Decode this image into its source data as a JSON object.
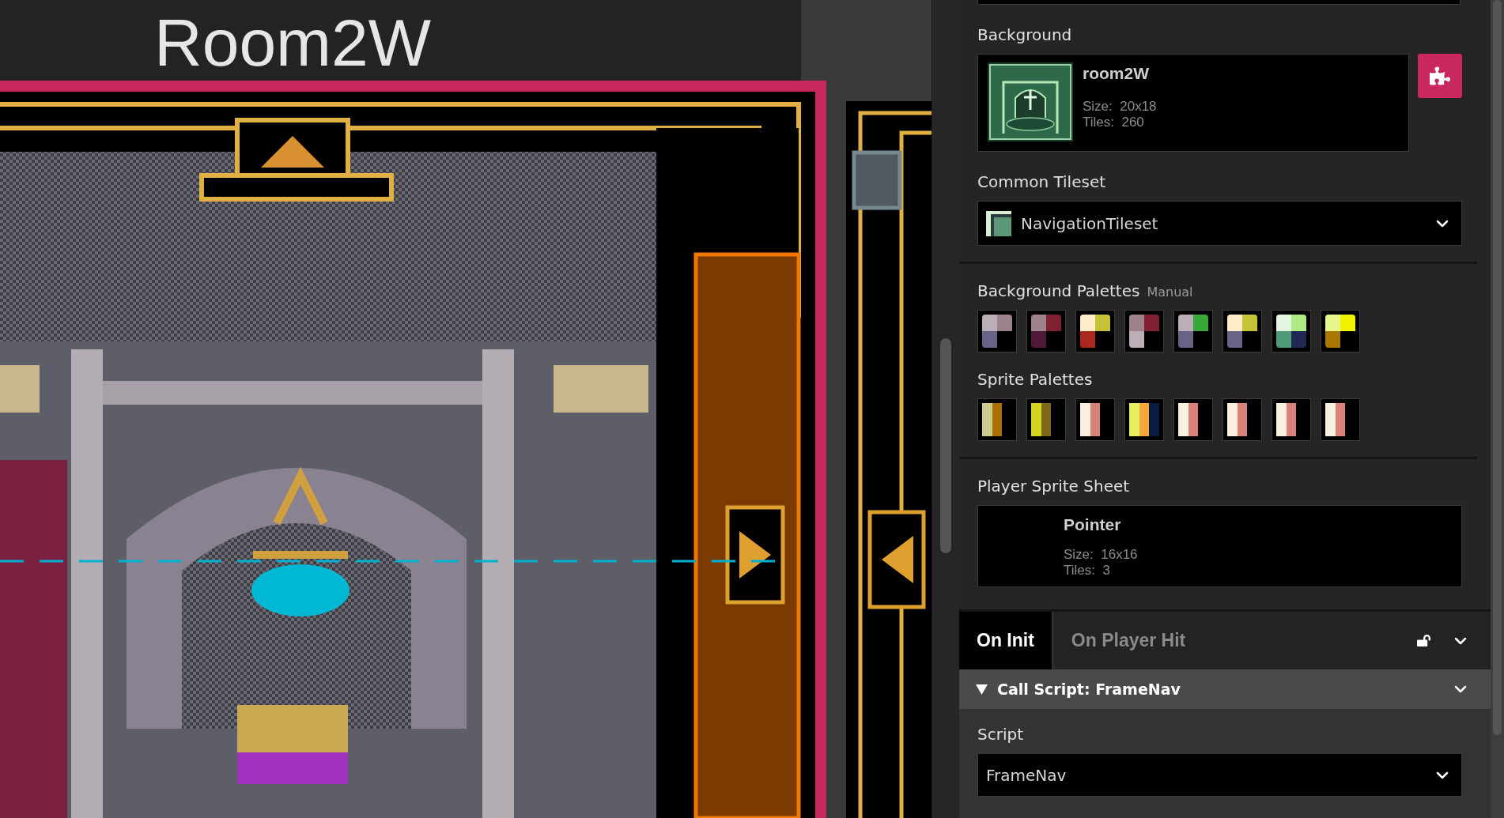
{
  "scene": {
    "title": "Room2W"
  },
  "sidebar": {
    "background": {
      "label": "Background",
      "name": "room2W",
      "size_label": "Size:",
      "size": "20x18",
      "tiles_label": "Tiles:",
      "tiles": "260"
    },
    "common_tileset": {
      "label": "Common Tileset",
      "value": "NavigationTileset"
    },
    "background_palettes": {
      "label": "Background Palettes",
      "mode": "Manual",
      "palettes": [
        {
          "swatches": [
            {
              "color": "#bcaeb6"
            },
            {
              "color": "#9e8289"
            },
            {
              "color": "#6a6385"
            }
          ]
        },
        {
          "swatches": [
            {
              "color": "#9e8289"
            },
            {
              "color": "#7f1f31"
            },
            {
              "color": "#4e1836"
            }
          ]
        },
        {
          "swatches": [
            {
              "color": "#fdecc8"
            },
            {
              "color": "#c6c436"
            },
            {
              "color": "#a92820"
            }
          ]
        },
        {
          "swatches": [
            {
              "color": "#9e8289"
            },
            {
              "color": "#7f1f31"
            },
            {
              "color": "#bcaeb6"
            }
          ]
        },
        {
          "swatches": [
            {
              "color": "#bcaeb6"
            },
            {
              "color": "#38a83a"
            },
            {
              "color": "#6a6385"
            }
          ]
        },
        {
          "swatches": [
            {
              "color": "#fdecc8"
            },
            {
              "color": "#c6c436"
            },
            {
              "color": "#6a6385"
            }
          ]
        },
        {
          "swatches": [
            {
              "color": "#e4f5e1"
            },
            {
              "color": "#aee987"
            },
            {
              "color": "#4f9a78"
            },
            {
              "color": "#1f2752"
            }
          ]
        },
        {
          "swatches": [
            {
              "color": "#e5f58a"
            },
            {
              "color": "#f0f000"
            },
            {
              "color": "#a87800"
            }
          ]
        }
      ]
    },
    "sprite_palettes": {
      "label": "Sprite Palettes",
      "palettes": [
        {
          "swatches": [
            {
              "color": "#cccc8c"
            },
            {
              "color": "#a87000"
            }
          ]
        },
        {
          "swatches": [
            {
              "color": "#d4d420"
            },
            {
              "color": "#806818"
            }
          ]
        },
        {
          "swatches": [
            {
              "color": "#faf0e0"
            },
            {
              "color": "#d8827a"
            }
          ]
        },
        {
          "swatches": [
            {
              "color": "#e8f060"
            },
            {
              "color": "#f8a838"
            },
            {
              "color": "#0a1a40"
            }
          ]
        },
        {
          "swatches": [
            {
              "color": "#faf0e0"
            },
            {
              "color": "#d8827a"
            }
          ]
        },
        {
          "swatches": [
            {
              "color": "#faf0e0"
            },
            {
              "color": "#d8827a"
            }
          ]
        },
        {
          "swatches": [
            {
              "color": "#faf0e0"
            },
            {
              "color": "#d8827a"
            }
          ]
        },
        {
          "swatches": [
            {
              "color": "#faf0e0"
            },
            {
              "color": "#d8827a"
            }
          ]
        }
      ]
    },
    "player_sprite_sheet": {
      "label": "Player Sprite Sheet",
      "name": "Pointer",
      "size_label": "Size:",
      "size": "16x16",
      "tiles_label": "Tiles:",
      "tiles": "3"
    },
    "tabs": [
      {
        "label": "On Init",
        "selected": true
      },
      {
        "label": "On Player Hit",
        "selected": false
      }
    ],
    "event": {
      "title": "Call Script: FrameNav",
      "expanded": true,
      "field_label": "Script",
      "value": "FrameNav"
    }
  }
}
